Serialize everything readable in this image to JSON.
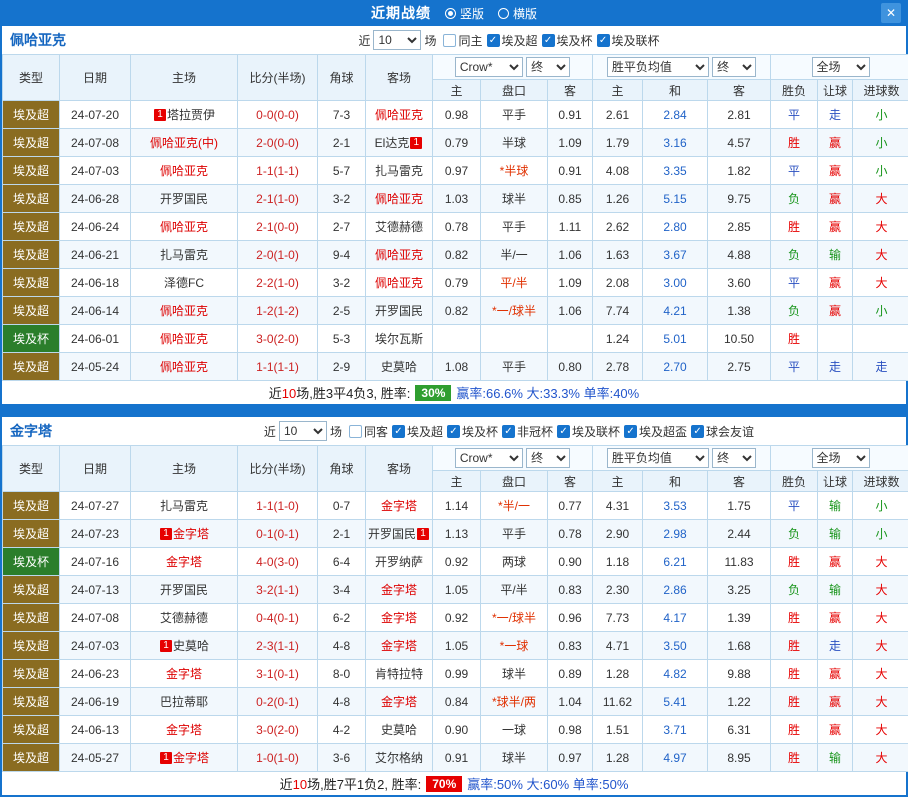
{
  "topbar": {
    "title": "近期战绩",
    "vertical_label": "竖版",
    "horizontal_label": "横版",
    "vertical_selected": true,
    "close_glyph": "✕"
  },
  "table_header": {
    "type": "类型",
    "date": "日期",
    "home": "主场",
    "score": "比分(半场)",
    "corner": "角球",
    "away": "客场",
    "odds_company": "Crow*",
    "final_label": "终",
    "avg_label": "胜平负均值",
    "scope_label": "全场",
    "odds_home": "主",
    "handicap": "盘口",
    "odds_away": "客",
    "avg_home": "主",
    "avg_draw": "和",
    "avg_away": "客",
    "result": "胜负",
    "spread": "让球",
    "goals": "进球数"
  },
  "colors": {
    "topbar_blue": "#1573cd",
    "league_colors": {
      "埃及超": "#8a6c21",
      "埃及杯": "#2b7e2b"
    },
    "outcome": {
      "胜": "#e60000",
      "负": "#18951b",
      "平": "#2a50c0",
      "赢": "#e60000",
      "输": "#18951b",
      "走": "#2a50c0",
      "大": "#e60000",
      "小": "#18951b"
    }
  },
  "sections": [
    {
      "team": "佩哈亚克",
      "filter": {
        "near": "近",
        "count": "10",
        "suffix": "场",
        "same": {
          "label": "同主",
          "checked": false
        },
        "leagues": [
          {
            "label": "埃及超",
            "checked": true
          },
          {
            "label": "埃及杯",
            "checked": true
          },
          {
            "label": "埃及联杯",
            "checked": true
          }
        ]
      },
      "rows": [
        {
          "league": "埃及超",
          "date": "24-07-20",
          "home_badge_before": "1",
          "home": "塔拉贾伊",
          "home_red": false,
          "home_badge_after": "",
          "score": "0-0(0-0)",
          "corner": "7-3",
          "away_badge_before": "",
          "away": "佩哈亚克",
          "away_red": true,
          "away_badge_after": "",
          "odds_home": "0.98",
          "handicap": "平手",
          "handicap_red": false,
          "odds_away": "0.91",
          "avg_home": "2.61",
          "avg_draw": "2.84",
          "avg_away": "2.81",
          "result": "平",
          "spread": "走",
          "goals": "小"
        },
        {
          "league": "埃及超",
          "date": "24-07-08",
          "home_badge_before": "",
          "home": "佩哈亚克(中)",
          "home_red": true,
          "home_badge_after": "",
          "score": "2-0(0-0)",
          "corner": "2-1",
          "away_badge_before": "",
          "away": "El达克",
          "away_red": false,
          "away_badge_after": "1",
          "odds_home": "0.79",
          "handicap": "半球",
          "handicap_red": false,
          "odds_away": "1.09",
          "avg_home": "1.79",
          "avg_draw": "3.16",
          "avg_away": "4.57",
          "result": "胜",
          "spread": "赢",
          "goals": "小"
        },
        {
          "league": "埃及超",
          "date": "24-07-03",
          "home_badge_before": "",
          "home": "佩哈亚克",
          "home_red": true,
          "home_badge_after": "",
          "score": "1-1(1-1)",
          "corner": "5-7",
          "away_badge_before": "",
          "away": "扎马雷克",
          "away_red": false,
          "away_badge_after": "",
          "odds_home": "0.97",
          "handicap": "*半球",
          "handicap_red": true,
          "odds_away": "0.91",
          "avg_home": "4.08",
          "avg_draw": "3.35",
          "avg_away": "1.82",
          "result": "平",
          "spread": "赢",
          "goals": "小"
        },
        {
          "league": "埃及超",
          "date": "24-06-28",
          "home_badge_before": "",
          "home": "开罗国民",
          "home_red": false,
          "home_badge_after": "",
          "score": "2-1(1-0)",
          "corner": "3-2",
          "away_badge_before": "",
          "away": "佩哈亚克",
          "away_red": true,
          "away_badge_after": "",
          "odds_home": "1.03",
          "handicap": "球半",
          "handicap_red": false,
          "odds_away": "0.85",
          "avg_home": "1.26",
          "avg_draw": "5.15",
          "avg_away": "9.75",
          "result": "负",
          "spread": "赢",
          "goals": "大"
        },
        {
          "league": "埃及超",
          "date": "24-06-24",
          "home_badge_before": "",
          "home": "佩哈亚克",
          "home_red": true,
          "home_badge_after": "",
          "score": "2-1(0-0)",
          "corner": "2-7",
          "away_badge_before": "",
          "away": "艾德赫德",
          "away_red": false,
          "away_badge_after": "",
          "odds_home": "0.78",
          "handicap": "平手",
          "handicap_red": false,
          "odds_away": "1.11",
          "avg_home": "2.62",
          "avg_draw": "2.80",
          "avg_away": "2.85",
          "result": "胜",
          "spread": "赢",
          "goals": "大"
        },
        {
          "league": "埃及超",
          "date": "24-06-21",
          "home_badge_before": "",
          "home": "扎马雷克",
          "home_red": false,
          "home_badge_after": "",
          "score": "2-0(1-0)",
          "corner": "9-4",
          "away_badge_before": "",
          "away": "佩哈亚克",
          "away_red": true,
          "away_badge_after": "",
          "odds_home": "0.82",
          "handicap": "半/一",
          "handicap_red": false,
          "odds_away": "1.06",
          "avg_home": "1.63",
          "avg_draw": "3.67",
          "avg_away": "4.88",
          "result": "负",
          "spread": "输",
          "goals": "大"
        },
        {
          "league": "埃及超",
          "date": "24-06-18",
          "home_badge_before": "",
          "home": "泽德FC",
          "home_red": false,
          "home_badge_after": "",
          "score": "2-2(1-0)",
          "corner": "3-2",
          "away_badge_before": "",
          "away": "佩哈亚克",
          "away_red": true,
          "away_badge_after": "",
          "odds_home": "0.79",
          "handicap": "平/半",
          "handicap_red": true,
          "odds_away": "1.09",
          "avg_home": "2.08",
          "avg_draw": "3.00",
          "avg_away": "3.60",
          "result": "平",
          "spread": "赢",
          "goals": "大"
        },
        {
          "league": "埃及超",
          "date": "24-06-14",
          "home_badge_before": "",
          "home": "佩哈亚克",
          "home_red": true,
          "home_badge_after": "",
          "score": "1-2(1-2)",
          "corner": "2-5",
          "away_badge_before": "",
          "away": "开罗国民",
          "away_red": false,
          "away_badge_after": "",
          "odds_home": "0.82",
          "handicap": "*一/球半",
          "handicap_red": true,
          "odds_away": "1.06",
          "avg_home": "7.74",
          "avg_draw": "4.21",
          "avg_away": "1.38",
          "result": "负",
          "spread": "赢",
          "goals": "小"
        },
        {
          "league": "埃及杯",
          "date": "24-06-01",
          "home_badge_before": "",
          "home": "佩哈亚克",
          "home_red": true,
          "home_badge_after": "",
          "score": "3-0(2-0)",
          "corner": "5-3",
          "away_badge_before": "",
          "away": "埃尔瓦斯",
          "away_red": false,
          "away_badge_after": "",
          "odds_home": "",
          "handicap": "",
          "handicap_red": false,
          "odds_away": "",
          "avg_home": "1.24",
          "avg_draw": "5.01",
          "avg_away": "10.50",
          "result": "胜",
          "spread": "",
          "goals": ""
        },
        {
          "league": "埃及超",
          "date": "24-05-24",
          "home_badge_before": "",
          "home": "佩哈亚克",
          "home_red": true,
          "home_badge_after": "",
          "score": "1-1(1-1)",
          "corner": "2-9",
          "away_badge_before": "",
          "away": "史莫哈",
          "away_red": false,
          "away_badge_after": "",
          "odds_home": "1.08",
          "handicap": "平手",
          "handicap_red": false,
          "odds_away": "0.80",
          "avg_home": "2.78",
          "avg_draw": "2.70",
          "avg_away": "2.75",
          "result": "平",
          "spread": "走",
          "goals": "走"
        }
      ],
      "summary": {
        "prefix": "近",
        "count": "10",
        "mid": "场,胜3平4负3, 胜率:",
        "badge": "30%",
        "badge_color": "#2f9e2f",
        "tail": "赢率:66.6% 大:33.3% 单率:40%"
      }
    },
    {
      "team": "金字塔",
      "filter": {
        "near": "近",
        "count": "10",
        "suffix": "场",
        "same": {
          "label": "同客",
          "checked": false
        },
        "leagues": [
          {
            "label": "埃及超",
            "checked": true
          },
          {
            "label": "埃及杯",
            "checked": true
          },
          {
            "label": "非冠杯",
            "checked": true
          },
          {
            "label": "埃及联杯",
            "checked": true
          },
          {
            "label": "埃及超盃",
            "checked": true
          },
          {
            "label": "球会友谊",
            "checked": true
          }
        ]
      },
      "rows": [
        {
          "league": "埃及超",
          "date": "24-07-27",
          "home_badge_before": "",
          "home": "扎马雷克",
          "home_red": false,
          "home_badge_after": "",
          "score": "1-1(1-0)",
          "corner": "0-7",
          "away_badge_before": "",
          "away": "金字塔",
          "away_red": true,
          "away_badge_after": "",
          "odds_home": "1.14",
          "handicap": "*半/一",
          "handicap_red": true,
          "odds_away": "0.77",
          "avg_home": "4.31",
          "avg_draw": "3.53",
          "avg_away": "1.75",
          "result": "平",
          "spread": "输",
          "goals": "小"
        },
        {
          "league": "埃及超",
          "date": "24-07-23",
          "home_badge_before": "1",
          "home": "金字塔",
          "home_red": true,
          "home_badge_after": "",
          "score": "0-1(0-1)",
          "corner": "2-1",
          "away_badge_before": "",
          "away": "开罗国民",
          "away_red": false,
          "away_badge_after": "1",
          "odds_home": "1.13",
          "handicap": "平手",
          "handicap_red": false,
          "odds_away": "0.78",
          "avg_home": "2.90",
          "avg_draw": "2.98",
          "avg_away": "2.44",
          "result": "负",
          "spread": "输",
          "goals": "小"
        },
        {
          "league": "埃及杯",
          "date": "24-07-16",
          "home_badge_before": "",
          "home": "金字塔",
          "home_red": true,
          "home_badge_after": "",
          "score": "4-0(3-0)",
          "corner": "6-4",
          "away_badge_before": "",
          "away": "开罗纳萨",
          "away_red": false,
          "away_badge_after": "",
          "odds_home": "0.92",
          "handicap": "两球",
          "handicap_red": false,
          "odds_away": "0.90",
          "avg_home": "1.18",
          "avg_draw": "6.21",
          "avg_away": "11.83",
          "result": "胜",
          "spread": "赢",
          "goals": "大"
        },
        {
          "league": "埃及超",
          "date": "24-07-13",
          "home_badge_before": "",
          "home": "开罗国民",
          "home_red": false,
          "home_badge_after": "",
          "score": "3-2(1-1)",
          "corner": "3-4",
          "away_badge_before": "",
          "away": "金字塔",
          "away_red": true,
          "away_badge_after": "",
          "odds_home": "1.05",
          "handicap": "平/半",
          "handicap_red": false,
          "odds_away": "0.83",
          "avg_home": "2.30",
          "avg_draw": "2.86",
          "avg_away": "3.25",
          "result": "负",
          "spread": "输",
          "goals": "大"
        },
        {
          "league": "埃及超",
          "date": "24-07-08",
          "home_badge_before": "",
          "home": "艾德赫德",
          "home_red": false,
          "home_badge_after": "",
          "score": "0-4(0-1)",
          "corner": "6-2",
          "away_badge_before": "",
          "away": "金字塔",
          "away_red": true,
          "away_badge_after": "",
          "odds_home": "0.92",
          "handicap": "*一/球半",
          "handicap_red": true,
          "odds_away": "0.96",
          "avg_home": "7.73",
          "avg_draw": "4.17",
          "avg_away": "1.39",
          "result": "胜",
          "spread": "赢",
          "goals": "大"
        },
        {
          "league": "埃及超",
          "date": "24-07-03",
          "home_badge_before": "1",
          "home": "史莫哈",
          "home_red": false,
          "home_badge_after": "",
          "score": "2-3(1-1)",
          "corner": "4-8",
          "away_badge_before": "",
          "away": "金字塔",
          "away_red": true,
          "away_badge_after": "",
          "odds_home": "1.05",
          "handicap": "*一球",
          "handicap_red": true,
          "odds_away": "0.83",
          "avg_home": "4.71",
          "avg_draw": "3.50",
          "avg_away": "1.68",
          "result": "胜",
          "spread": "走",
          "goals": "大"
        },
        {
          "league": "埃及超",
          "date": "24-06-23",
          "home_badge_before": "",
          "home": "金字塔",
          "home_red": true,
          "home_badge_after": "",
          "score": "3-1(0-1)",
          "corner": "8-0",
          "away_badge_before": "",
          "away": "肯特拉特",
          "away_red": false,
          "away_badge_after": "",
          "odds_home": "0.99",
          "handicap": "球半",
          "handicap_red": false,
          "odds_away": "0.89",
          "avg_home": "1.28",
          "avg_draw": "4.82",
          "avg_away": "9.88",
          "result": "胜",
          "spread": "赢",
          "goals": "大"
        },
        {
          "league": "埃及超",
          "date": "24-06-19",
          "home_badge_before": "",
          "home": "巴拉蒂耶",
          "home_red": false,
          "home_badge_after": "",
          "score": "0-2(0-1)",
          "corner": "4-8",
          "away_badge_before": "",
          "away": "金字塔",
          "away_red": true,
          "away_badge_after": "",
          "odds_home": "0.84",
          "handicap": "*球半/两",
          "handicap_red": true,
          "odds_away": "1.04",
          "avg_home": "11.62",
          "avg_draw": "5.41",
          "avg_away": "1.22",
          "result": "胜",
          "spread": "赢",
          "goals": "大"
        },
        {
          "league": "埃及超",
          "date": "24-06-13",
          "home_badge_before": "",
          "home": "金字塔",
          "home_red": true,
          "home_badge_after": "",
          "score": "3-0(2-0)",
          "corner": "4-2",
          "away_badge_before": "",
          "away": "史莫哈",
          "away_red": false,
          "away_badge_after": "",
          "odds_home": "0.90",
          "handicap": "一球",
          "handicap_red": false,
          "odds_away": "0.98",
          "avg_home": "1.51",
          "avg_draw": "3.71",
          "avg_away": "6.31",
          "result": "胜",
          "spread": "赢",
          "goals": "大"
        },
        {
          "league": "埃及超",
          "date": "24-05-27",
          "home_badge_before": "1",
          "home": "金字塔",
          "home_red": true,
          "home_badge_after": "",
          "score": "1-0(1-0)",
          "corner": "3-6",
          "away_badge_before": "",
          "away": "艾尔格纳",
          "away_red": false,
          "away_badge_after": "",
          "odds_home": "0.91",
          "handicap": "球半",
          "handicap_red": false,
          "odds_away": "0.97",
          "avg_home": "1.28",
          "avg_draw": "4.97",
          "avg_away": "8.95",
          "result": "胜",
          "spread": "输",
          "goals": "大"
        }
      ],
      "summary": {
        "prefix": "近",
        "count": "10",
        "mid": "场,胜7平1负2, 胜率:",
        "badge": "70%",
        "badge_color": "#e60000",
        "tail": "赢率:50% 大:60% 单率:50%"
      }
    }
  ]
}
